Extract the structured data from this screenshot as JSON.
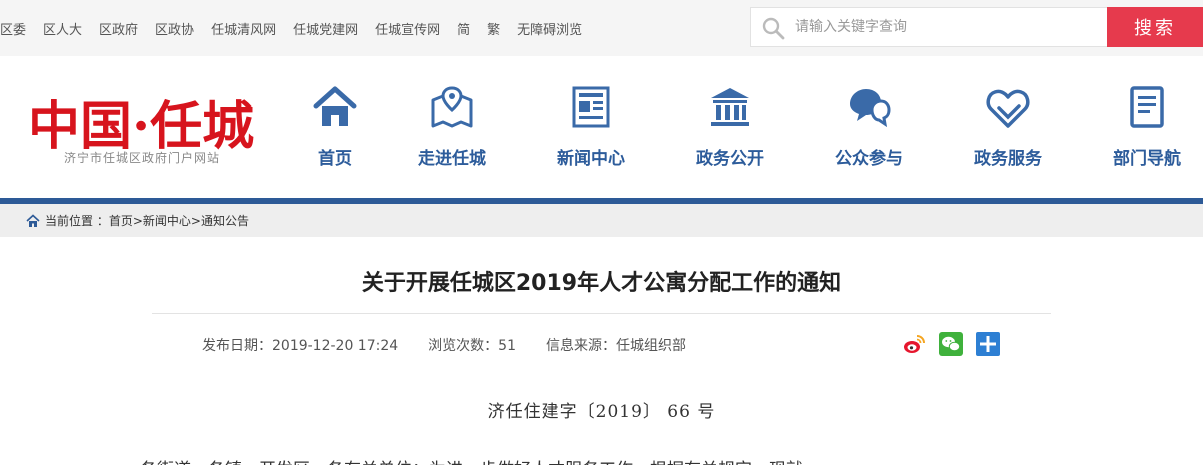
{
  "topbar": {
    "links": [
      "区委",
      "区人大",
      "区政府",
      "区政协",
      "任城清风网",
      "任城党建网",
      "任城宣传网",
      "简",
      "繁",
      "无障碍浏览"
    ],
    "search_placeholder": "请输入关键字查询",
    "search_button": "搜索"
  },
  "header": {
    "logo_text": "中国·任城",
    "logo_subtitle": "济宁市任城区政府门户网站",
    "nav": [
      {
        "label": "首页",
        "icon": "home-icon"
      },
      {
        "label": "走进任城",
        "icon": "map-pin-icon"
      },
      {
        "label": "新闻中心",
        "icon": "newspaper-icon"
      },
      {
        "label": "政务公开",
        "icon": "government-building-icon"
      },
      {
        "label": "公众参与",
        "icon": "chat-bubbles-icon"
      },
      {
        "label": "政务服务",
        "icon": "heart-tag-icon"
      },
      {
        "label": "部门导航",
        "icon": "document-list-icon"
      }
    ],
    "accent_color": "#2d5a97"
  },
  "breadcrumb": {
    "label": "当前位置 ：",
    "items": [
      "首页>",
      "新闻中心>",
      "通知公告"
    ]
  },
  "article": {
    "title": "关于开展任城区2019年人才公寓分配工作的通知",
    "publish_date": "发布日期：2019-12-20 17:24",
    "views": "浏览次数：51",
    "source": "信息来源：任城组织部",
    "share_icons": [
      "weibo-icon",
      "wechat-icon",
      "plus-share-icon"
    ],
    "doc_number": "济任住建字〔2019〕 66 号",
    "body_first_line": "各街道、各镇、开发区、各有关单位：为进一步做好人才服务工作，根据有关规定，现就"
  }
}
